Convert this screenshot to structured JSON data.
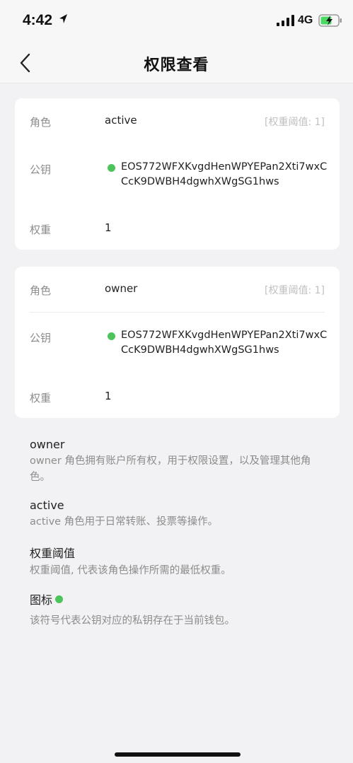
{
  "status_bar": {
    "time": "4:42",
    "network": "4G",
    "icons": [
      "location-arrow-icon",
      "signal-icon",
      "battery-charging-icon"
    ]
  },
  "nav": {
    "title": "权限查看",
    "back_icon": "chevron-left-icon"
  },
  "permissions": [
    {
      "role_label": "角色",
      "role": "active",
      "threshold": "[权重阈值: 1]",
      "key_label": "公钥",
      "public_key": "EOS772WFXKvgdHenWPYEPan2Xti7wxCCcK9DWBH4dgwhXWgSG1hws",
      "weight_label": "权重",
      "weight": "1"
    },
    {
      "role_label": "角色",
      "role": "owner",
      "threshold": "[权重阈值: 1]",
      "key_label": "公钥",
      "public_key": "EOS772WFXKvgdHenWPYEPan2Xti7wxCCcK9DWBH4dgwhXWgSG1hws",
      "weight_label": "权重",
      "weight": "1"
    }
  ],
  "explanations": [
    {
      "title": "owner",
      "desc": "owner 角色拥有账户所有权，用于权限设置，以及管理其他角色。"
    },
    {
      "title": "active",
      "desc": "active 角色用于日常转账、投票等操作。"
    },
    {
      "title": "权重阈值",
      "desc": "权重阈值, 代表该角色操作所需的最低权重。"
    },
    {
      "title": "图标",
      "desc": "该符号代表公钥对应的私钥存在于当前钱包。"
    }
  ],
  "colors": {
    "key_indicator": "#4cc45c",
    "background": "#f2f2f4",
    "card": "#ffffff",
    "muted_text": "#8c8c8c"
  }
}
